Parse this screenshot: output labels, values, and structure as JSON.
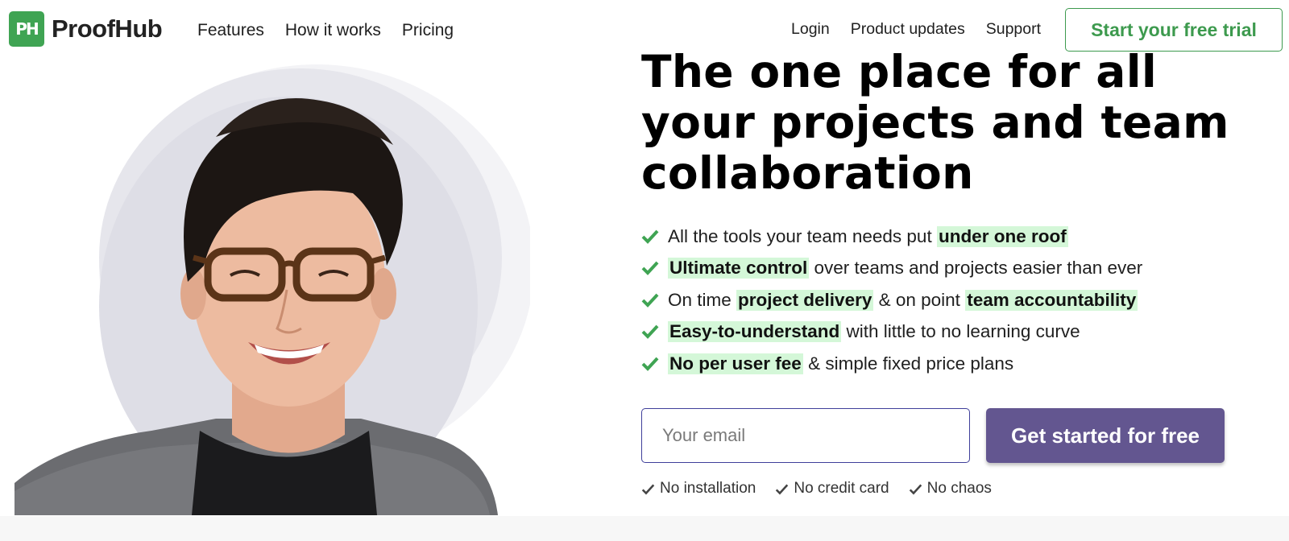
{
  "brand": {
    "logo_mark": "PH",
    "name": "ProofHub",
    "color": "#3fa453"
  },
  "nav": {
    "left": [
      {
        "label": "Features"
      },
      {
        "label": "How it works"
      },
      {
        "label": "Pricing"
      }
    ],
    "right": [
      {
        "label": "Login"
      },
      {
        "label": "Product updates"
      },
      {
        "label": "Support"
      }
    ],
    "trial_button": "Start your free trial"
  },
  "hero": {
    "headline": "The one place for all your projects and team collaboration",
    "image_icon": "smiling-woman-with-glasses-photo",
    "benefits": [
      [
        {
          "text": "All the tools your team needs put ",
          "hl": false
        },
        {
          "text": "under one roof",
          "hl": true
        }
      ],
      [
        {
          "text": "Ultimate control",
          "hl": true
        },
        {
          "text": " over teams and projects easier than ever",
          "hl": false
        }
      ],
      [
        {
          "text": "On time ",
          "hl": false
        },
        {
          "text": "project delivery",
          "hl": true
        },
        {
          "text": " & on point ",
          "hl": false
        },
        {
          "text": "team accountability",
          "hl": true
        }
      ],
      [
        {
          "text": "Easy-to-understand",
          "hl": true
        },
        {
          "text": " with little to no learning curve",
          "hl": false
        }
      ],
      [
        {
          "text": "No per user fee",
          "hl": true
        },
        {
          "text": " & simple fixed price plans",
          "hl": false
        }
      ]
    ],
    "check_icon": "check-icon",
    "highlight_color": "#d4f7d8"
  },
  "signup": {
    "email_placeholder": "Your email",
    "cta_label": "Get started for free",
    "cta_color": "#635690",
    "perks": [
      "No installation",
      "No credit card",
      "No chaos"
    ]
  }
}
